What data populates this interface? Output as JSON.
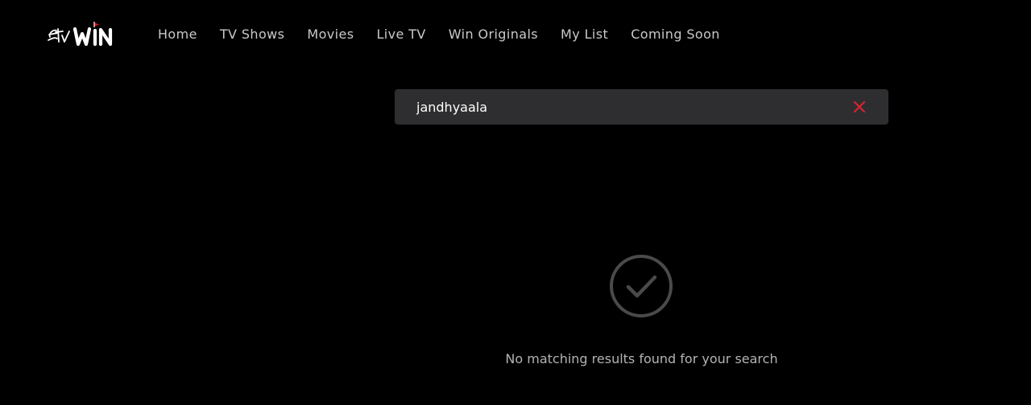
{
  "brand": {
    "logo_text": "WIN",
    "logo_script": "Etv",
    "accent_color": "#e50914"
  },
  "nav": {
    "items": [
      {
        "label": "Home"
      },
      {
        "label": "TV Shows"
      },
      {
        "label": "Movies"
      },
      {
        "label": "Live TV"
      },
      {
        "label": "Win Originals"
      },
      {
        "label": "My List"
      },
      {
        "label": "Coming Soon"
      }
    ]
  },
  "search": {
    "value": "jandhyaala",
    "placeholder": "",
    "clear_icon": "close-icon",
    "clear_color": "#d9232e"
  },
  "results": {
    "empty_icon": "check-circle-icon",
    "empty_message": "No matching results found for your search"
  }
}
